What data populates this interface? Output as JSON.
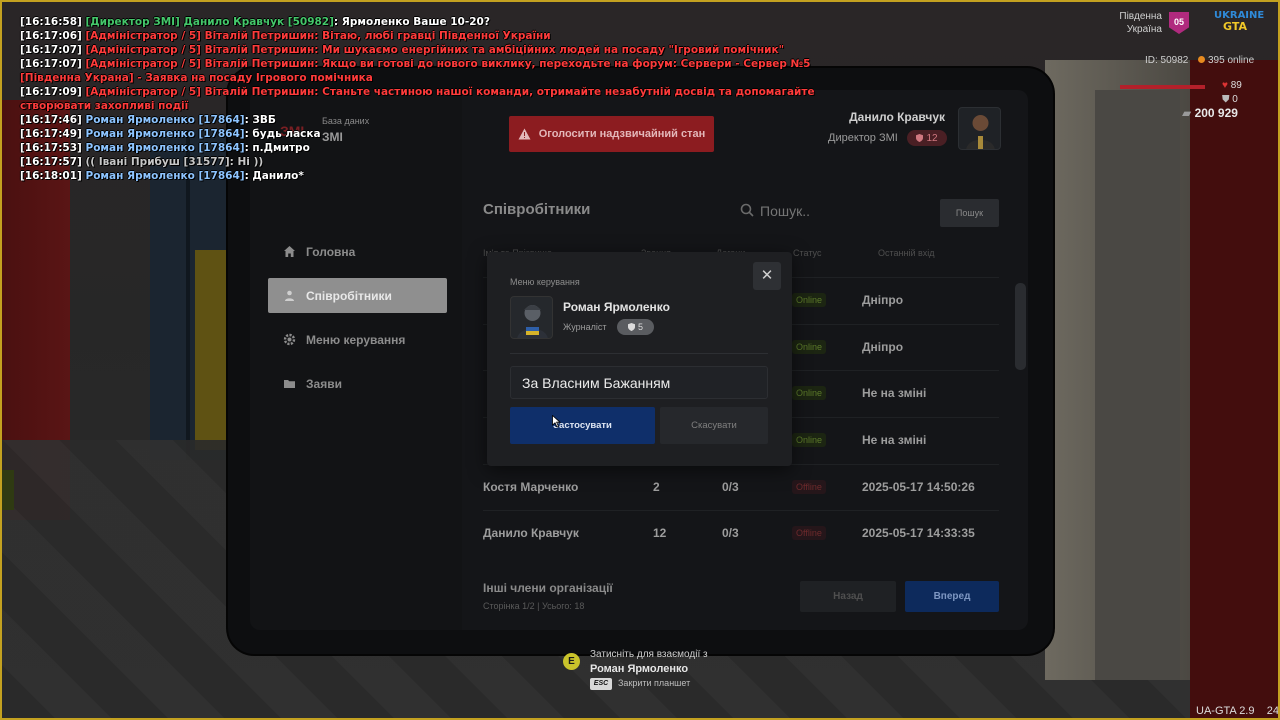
{
  "chat": [
    {
      "time": "[16:16:58]",
      "parts": [
        {
          "t": " [Директор ЗМІ]  Данило Кравчук [50982]",
          "c": "green"
        },
        {
          "t": ": Ярмоленко Ваше 10-20?",
          "c": "white"
        }
      ]
    },
    {
      "time": "[16:17:06]",
      "parts": [
        {
          "t": " [Адміністратор / 5] Віталій Петришин: Вітаю, любі гравці Південної України",
          "c": "red"
        }
      ]
    },
    {
      "time": "[16:17:07]",
      "parts": [
        {
          "t": " [Адміністратор / 5] Віталій Петришин: Ми шукаємо енергійних та амбіційних людей на посаду \"Ігровий помічник\"",
          "c": "red"
        }
      ]
    },
    {
      "time": "[16:17:07]",
      "parts": [
        {
          "t": " [Адміністратор / 5] Віталій Петришин: Якщо ви готові до нового виклику, переходьте на форум: Сервери - Сервер №5 [Південна Украна] - Заявка на посаду Ігрового помічника",
          "c": "red"
        }
      ]
    },
    {
      "time": "[16:17:09]",
      "parts": [
        {
          "t": " [Адміністратор / 5] Віталій Петришин: Станьте частиною нашої команди, отримайте незабутній досвід та допомагайте створювати захопливі події",
          "c": "red"
        }
      ]
    },
    {
      "time": "[16:17:46]",
      "parts": [
        {
          "t": " Роман Ярмоленко [17864]",
          "c": "blue"
        },
        {
          "t": ": ЗВБ",
          "c": "white"
        }
      ]
    },
    {
      "time": "[16:17:49]",
      "parts": [
        {
          "t": " Роман Ярмоленко [17864]",
          "c": "blue"
        },
        {
          "t": ": будь ласка",
          "c": "white"
        }
      ]
    },
    {
      "time": "[16:17:53]",
      "parts": [
        {
          "t": " Роман Ярмоленко [17864]",
          "c": "blue"
        },
        {
          "t": ": п.Дмитро",
          "c": "white"
        }
      ]
    },
    {
      "time": "[16:17:57]",
      "parts": [
        {
          "t": " (( Івані Прибуш [31577]: Hi ))",
          "c": "gray"
        }
      ]
    },
    {
      "time": "[16:18:01]",
      "parts": [
        {
          "t": " Роман Ярмоленко [17864]",
          "c": "blue"
        },
        {
          "t": ": Данило*",
          "c": "white"
        }
      ]
    }
  ],
  "hud": {
    "region_line1": "Південна",
    "region_line2": "Україна",
    "server_badge": "05",
    "logo_line1": "UKRAINE",
    "logo_line2": "GTA",
    "player_id": "ID: 50982",
    "online": "395 online",
    "health": "89",
    "health_fraction": 0.89,
    "armor": "0",
    "money": "200 929",
    "version": "UA-GTA 2.9",
    "version_extra": "24"
  },
  "tablet": {
    "brand_logo": "ЗМІ",
    "brand_sub": "База даних",
    "brand_name": "ЗМІ",
    "nav": [
      {
        "label": "Головна",
        "icon": "home-icon"
      },
      {
        "label": "Співробітники",
        "icon": "users-icon"
      },
      {
        "label": "Меню керування",
        "icon": "gear-icon"
      },
      {
        "label": "Заяви",
        "icon": "folder-icon"
      }
    ],
    "alert_button": "Оголосити надзвичайний стан",
    "user": {
      "name": "Данило Кравчук",
      "role": "Директор ЗМІ",
      "rank": "12"
    },
    "section_title": "Співробітники",
    "search_placeholder": "Пошук..",
    "search_button": "Пошук",
    "columns": [
      "Ім'я та Прізвище",
      "Звання",
      "Догани",
      "Статус",
      "Останній вхід"
    ],
    "rows": [
      {
        "name": "",
        "rank": "",
        "warns": "",
        "status": "Online",
        "status_kind": "on",
        "last": "Дніпро"
      },
      {
        "name": "",
        "rank": "",
        "warns": "",
        "status": "Online",
        "status_kind": "on",
        "last": "Дніпро"
      },
      {
        "name": "",
        "rank": "",
        "warns": "",
        "status": "Online",
        "status_kind": "on",
        "last": "Не на зміні"
      },
      {
        "name": "",
        "rank": "",
        "warns": "",
        "status": "Online",
        "status_kind": "on",
        "last": "Не на зміні"
      },
      {
        "name": "Костя Марченко",
        "rank": "2",
        "warns": "0/3",
        "status": "Offline",
        "status_kind": "off",
        "last": "2025-05-17 14:50:26"
      },
      {
        "name": "Данило Кравчук",
        "rank": "12",
        "warns": "0/3",
        "status": "Offline",
        "status_kind": "off",
        "last": "2025-05-17 14:33:35"
      }
    ],
    "others_title": "Інші члени організації",
    "page_info": "Сторінка 1/2 | Усього: 18",
    "prev_button": "Назад",
    "next_button": "Вперед"
  },
  "modal": {
    "title": "Меню керування",
    "close": "✕",
    "name": "Роман Ярмоленко",
    "role": "Журналіст",
    "rank": "5",
    "reason_value": "За Власним Бажанням",
    "apply_button": "Застосувати",
    "cancel_button": "Скасувати"
  },
  "prompt": {
    "key": "E",
    "text": "Затисніть для взаємодії з",
    "target": "Роман Ярмоленко",
    "esc_key": "ESC",
    "esc_label": "Закрити планшет"
  },
  "colors": {
    "accent_red": "#8c1c20",
    "accent_blue": "#0f2f6a",
    "chat_red": "#ff3b3b",
    "chat_blue": "#8dc4ff",
    "chat_green": "#44c76a"
  }
}
